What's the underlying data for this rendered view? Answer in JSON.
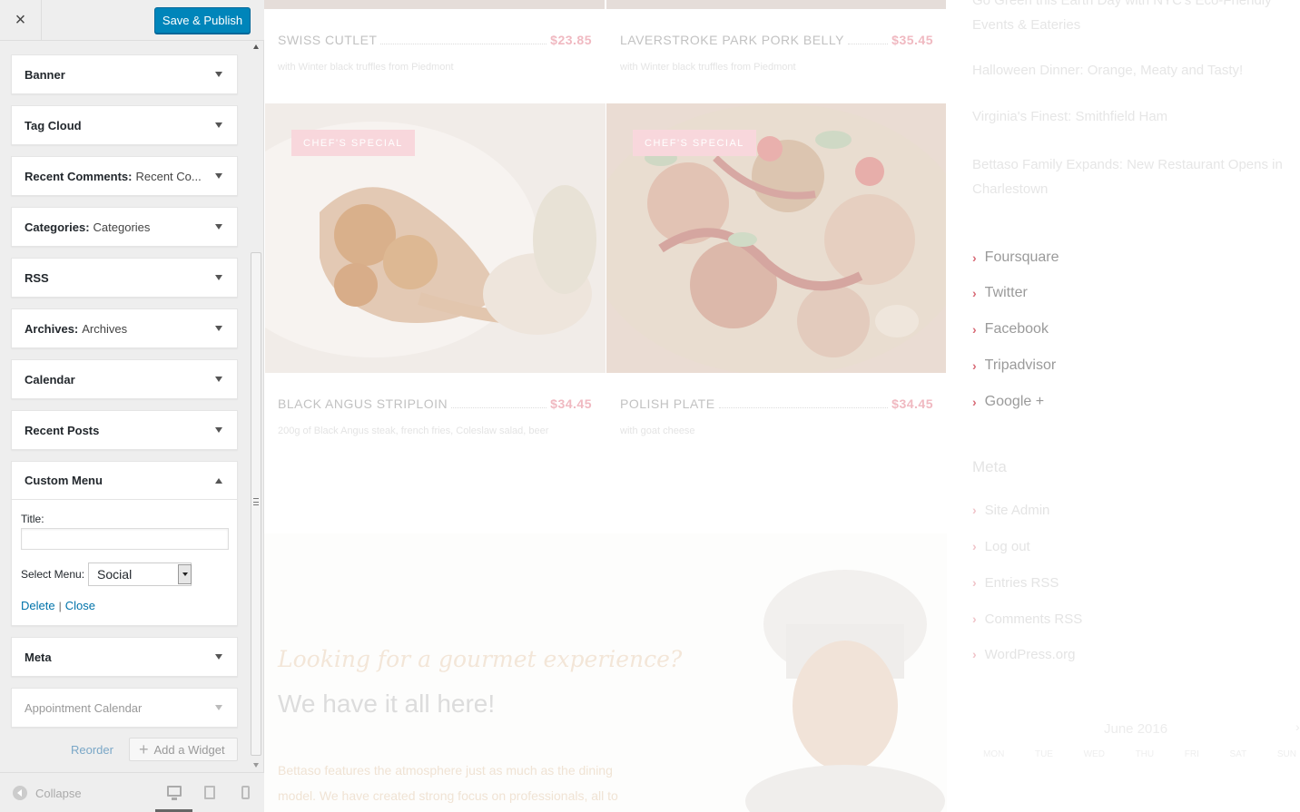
{
  "sidebar": {
    "close_label": "×",
    "save_label": "Save & Publish",
    "widgets": [
      {
        "title": "Banner",
        "subtitle": ""
      },
      {
        "title": "Tag Cloud",
        "subtitle": ""
      },
      {
        "title": "Recent Comments:",
        "subtitle": "Recent Co..."
      },
      {
        "title": "Categories:",
        "subtitle": "Categories"
      },
      {
        "title": "RSS",
        "subtitle": ""
      },
      {
        "title": "Archives:",
        "subtitle": "Archives"
      },
      {
        "title": "Calendar",
        "subtitle": ""
      },
      {
        "title": "Recent Posts",
        "subtitle": ""
      }
    ],
    "custom_menu": {
      "title": "Custom Menu",
      "title_label": "Title:",
      "title_value": "",
      "select_label": "Select Menu:",
      "select_value": "Social",
      "delete_label": "Delete",
      "separator": "|",
      "close_label": "Close"
    },
    "widgets_after": [
      {
        "title": "Meta"
      },
      {
        "title": "Appointment Calendar"
      }
    ],
    "reorder_label": "Reorder",
    "add_widget_label": "Add a Widget",
    "collapse_label": "Collapse"
  },
  "preview": {
    "dishes": [
      {
        "name": "SWISS CUTLET",
        "price": "$23.85",
        "desc": "with Winter black truffles from Piedmont"
      },
      {
        "name": "LAVERSTROKE PARK PORK BELLY",
        "price": "$35.45",
        "desc": "with Winter black truffles from Piedmont"
      },
      {
        "name": "BLACK ANGUS STRIPLOIN",
        "price": "$34.45",
        "desc": "200g of Black Angus steak, french fries, Coleslaw salad, beer"
      },
      {
        "name": "POLISH PLATE",
        "price": "$34.45",
        "desc": "with goat cheese"
      }
    ],
    "badge": "CHEF'S SPECIAL",
    "promo": {
      "script": "Looking for a gourmet experience?",
      "heading": "We have it all here!",
      "text1": "Bettaso  features the atmosphere just as much as the dining",
      "text2": "model. We have created  strong focus on professionals, all to"
    },
    "posts": [
      "Go Green this Earth Day with NYC's Eco-Friendly Events & Eateries",
      "Halloween Dinner: Orange, Meaty and Tasty!",
      "Virginia's Finest: Smithfield Ham",
      "Bettaso Family Expands: New Restaurant Opens in Charlestown"
    ],
    "social": [
      "Foursquare",
      "Twitter",
      "Facebook",
      "Tripadvisor",
      "Google +"
    ],
    "meta_title": "Meta",
    "meta": [
      "Site Admin",
      "Log out",
      "Entries RSS",
      "Comments RSS",
      "WordPress.org"
    ],
    "calendar": {
      "title": "June 2016",
      "next": "›",
      "days": [
        "MON",
        "TUE",
        "WED",
        "THU",
        "FRI",
        "SAT",
        "SUN"
      ]
    }
  },
  "colors": {
    "primary_button": "#0085ba",
    "link": "#0073aa",
    "price": "#f0b9c1",
    "badge": "#f8d7dc",
    "chevron": "#d86a76"
  }
}
